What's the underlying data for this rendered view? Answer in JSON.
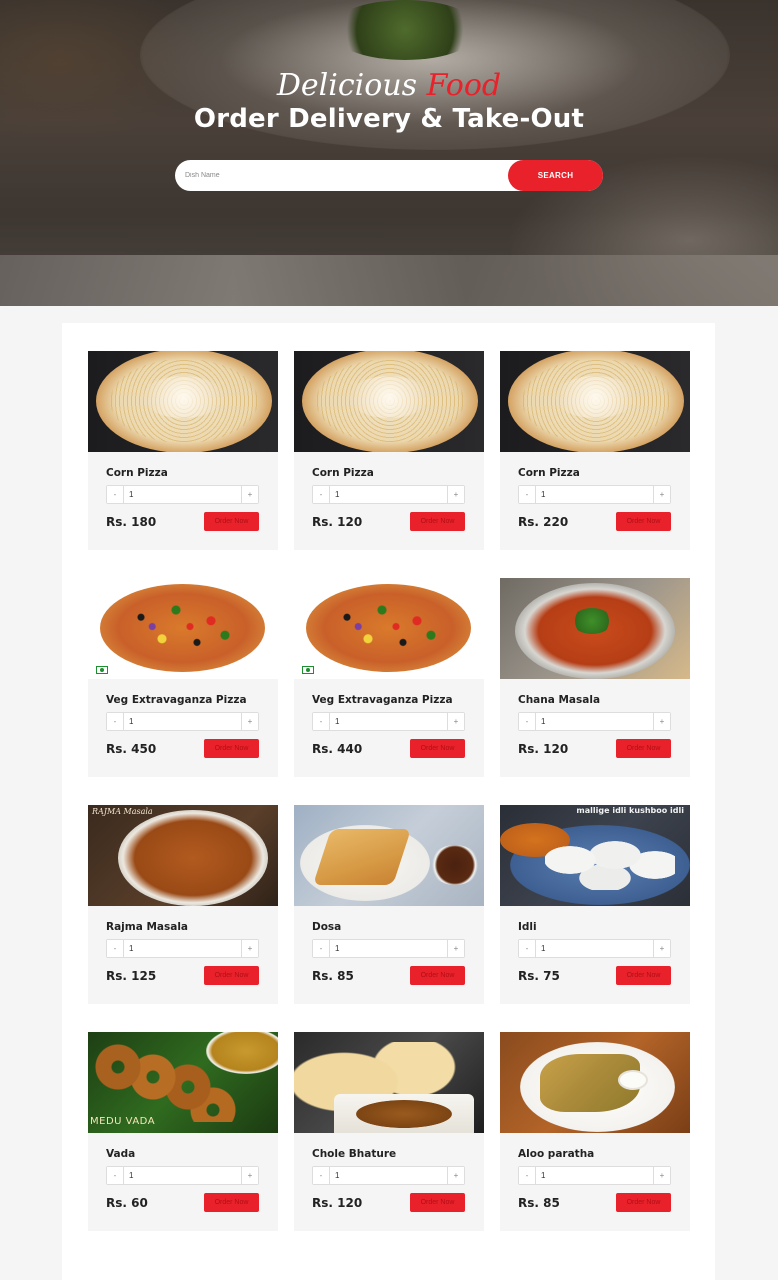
{
  "hero": {
    "title_part1": "Delicious",
    "title_part2": "Food",
    "subtitle": "Order Delivery & Take-Out",
    "search_placeholder": "Dish Name",
    "search_button": "SEARCH"
  },
  "colors": {
    "accent": "#e8212a",
    "card_bg": "#f5f5f5",
    "panel_bg": "#ffffff"
  },
  "order_label": "Order Now",
  "qty_minus": "-",
  "qty_plus": "+",
  "items": [
    {
      "name": "Corn Pizza",
      "qty": "1",
      "price": "Rs. 180",
      "image": "corn-pizza-image"
    },
    {
      "name": "Corn Pizza",
      "qty": "1",
      "price": "Rs. 120",
      "image": "corn-pizza-image"
    },
    {
      "name": "Corn Pizza",
      "qty": "1",
      "price": "Rs. 220",
      "image": "corn-pizza-image"
    },
    {
      "name": "Veg Extravaganza Pizza",
      "qty": "1",
      "price": "Rs. 450",
      "image": "veg-pizza-image"
    },
    {
      "name": "Veg Extravaganza Pizza",
      "qty": "1",
      "price": "Rs. 440",
      "image": "veg-pizza-image"
    },
    {
      "name": "Chana Masala",
      "qty": "1",
      "price": "Rs. 120",
      "image": "chana-masala-image"
    },
    {
      "name": "Rajma Masala",
      "qty": "1",
      "price": "Rs. 125",
      "image": "rajma-masala-image",
      "image_text": "RAJMA Masala"
    },
    {
      "name": "Dosa",
      "qty": "1",
      "price": "Rs. 85",
      "image": "dosa-image"
    },
    {
      "name": "Idli",
      "qty": "1",
      "price": "Rs. 75",
      "image": "idli-image",
      "image_text": "mallige idli kushboo idli"
    },
    {
      "name": "Vada",
      "qty": "1",
      "price": "Rs. 60",
      "image": "vada-image",
      "image_text": "MEDU VADA"
    },
    {
      "name": "Chole Bhature",
      "qty": "1",
      "price": "Rs. 120",
      "image": "chole-bhature-image"
    },
    {
      "name": "Aloo paratha",
      "qty": "1",
      "price": "Rs. 85",
      "image": "aloo-paratha-image"
    }
  ]
}
